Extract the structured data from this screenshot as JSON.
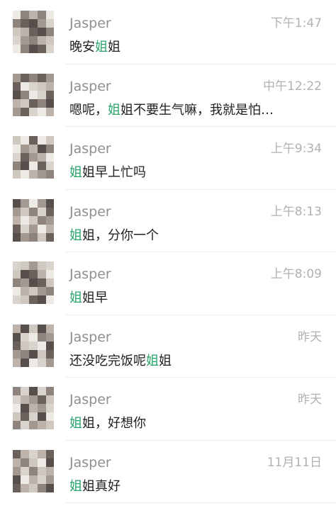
{
  "colors": {
    "name": "#8f8f8f",
    "time": "#b1b1b1",
    "preview": "#1f1f1f",
    "highlight": "#27a36a",
    "divider": "#ececec"
  },
  "avatar_icon": "blurred-avatar",
  "conversations": [
    {
      "name": "Jasper",
      "time": "下午1:47",
      "preview": [
        {
          "t": "晚安"
        },
        {
          "t": "姐",
          "hl": true
        },
        {
          "t": "姐"
        }
      ]
    },
    {
      "name": "Jasper",
      "time": "中午12:22",
      "preview": [
        {
          "t": "嗯呢，"
        },
        {
          "t": "姐",
          "hl": true
        },
        {
          "t": "姐不要生气嘛，我就是怕…"
        }
      ]
    },
    {
      "name": "Jasper",
      "time": "上午9:34",
      "preview": [
        {
          "t": "姐",
          "hl": true
        },
        {
          "t": "姐早上忙吗"
        }
      ]
    },
    {
      "name": "Jasper",
      "time": "上午8:13",
      "preview": [
        {
          "t": "姐",
          "hl": true
        },
        {
          "t": "姐，分你一个"
        }
      ]
    },
    {
      "name": "Jasper",
      "time": "上午8:09",
      "preview": [
        {
          "t": "姐",
          "hl": true
        },
        {
          "t": "姐早"
        }
      ]
    },
    {
      "name": "Jasper",
      "time": "昨天",
      "preview": [
        {
          "t": "还没吃完饭呢"
        },
        {
          "t": "姐",
          "hl": true
        },
        {
          "t": "姐"
        }
      ]
    },
    {
      "name": "Jasper",
      "time": "昨天",
      "preview": [
        {
          "t": "姐",
          "hl": true
        },
        {
          "t": "姐，好想你"
        }
      ]
    },
    {
      "name": "Jasper",
      "time": "11月11日",
      "preview": [
        {
          "t": "姐",
          "hl": true
        },
        {
          "t": "姐真好"
        }
      ]
    }
  ]
}
